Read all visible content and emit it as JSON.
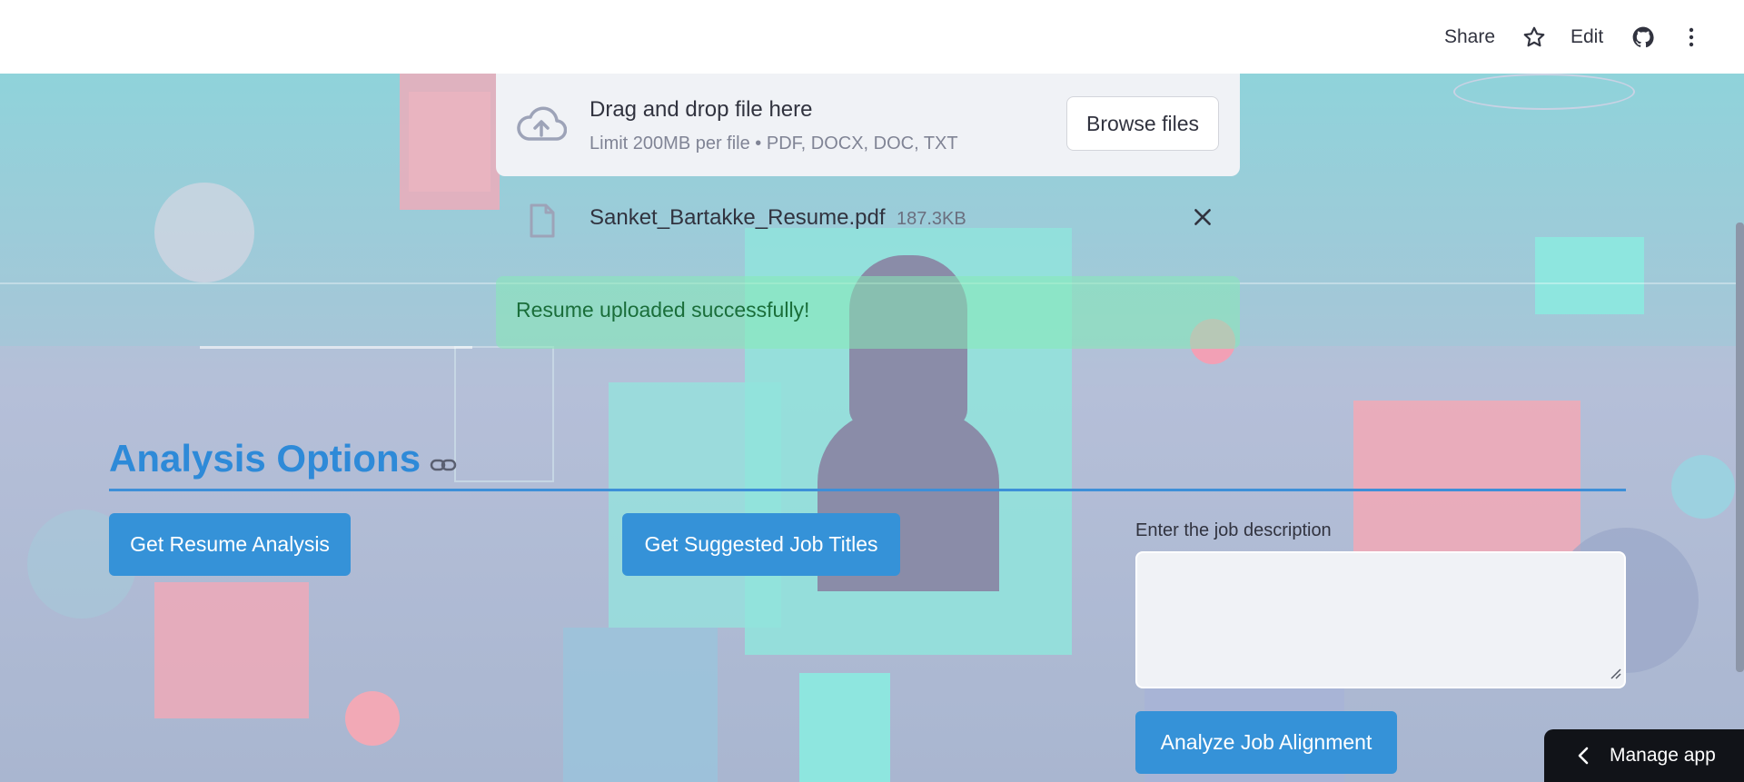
{
  "header": {
    "share_label": "Share",
    "edit_label": "Edit",
    "icons": [
      "star-icon",
      "github-icon",
      "kebab-menu-icon"
    ]
  },
  "uploader": {
    "title": "Drag and drop file here",
    "limit_text": "Limit 200MB per file • PDF, DOCX, DOC, TXT",
    "browse_label": "Browse files",
    "icon": "cloud-upload-icon"
  },
  "uploaded_file": {
    "name": "Sanket_Bartakke_Resume.pdf",
    "size": "187.3KB",
    "icon": "file-icon"
  },
  "alert": {
    "message": "Resume uploaded successfully!",
    "color": "#1a6e3a"
  },
  "analysis": {
    "title": "Analysis Options",
    "resume_button": "Get Resume Analysis",
    "job_titles_button": "Get Suggested Job Titles",
    "jd_label": "Enter the job description",
    "jd_value": "",
    "align_button": "Analyze Job Alignment"
  },
  "footer": {
    "manage_app_label": "Manage app"
  },
  "colors": {
    "accent": "#3592d8",
    "title": "#2e8ad8"
  }
}
